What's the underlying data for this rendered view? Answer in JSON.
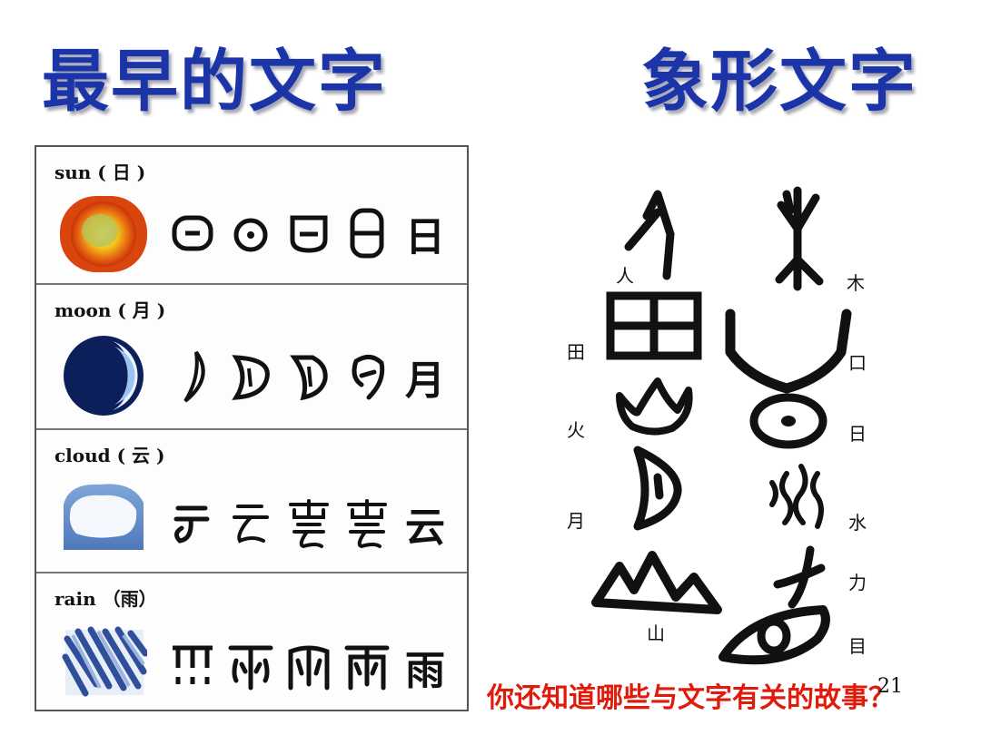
{
  "slide": {
    "title_left": "最早的文字",
    "title_right": "象形文字",
    "question": "你还知道哪些与文字有关的故事？",
    "page_number": "21"
  },
  "evolution_chart": {
    "rows": [
      {
        "label": "sun",
        "han": "日",
        "final_glyph": "日"
      },
      {
        "label": "moon",
        "han": "月",
        "final_glyph": "月"
      },
      {
        "label": "cloud",
        "han": "云",
        "final_glyph": "云"
      },
      {
        "label": "rain",
        "han": "雨",
        "final_glyph": "雨"
      }
    ]
  },
  "pictograph_chart": {
    "labels": {
      "ren": "人",
      "mu": "木",
      "tian": "田",
      "kou": "口",
      "huo": "火",
      "ri": "日",
      "yue": "月",
      "shui": "水",
      "li": "力",
      "shan": "山",
      "mu_eye": "目"
    }
  },
  "colors": {
    "title": "#1b35a8",
    "question": "#e01b0c"
  }
}
